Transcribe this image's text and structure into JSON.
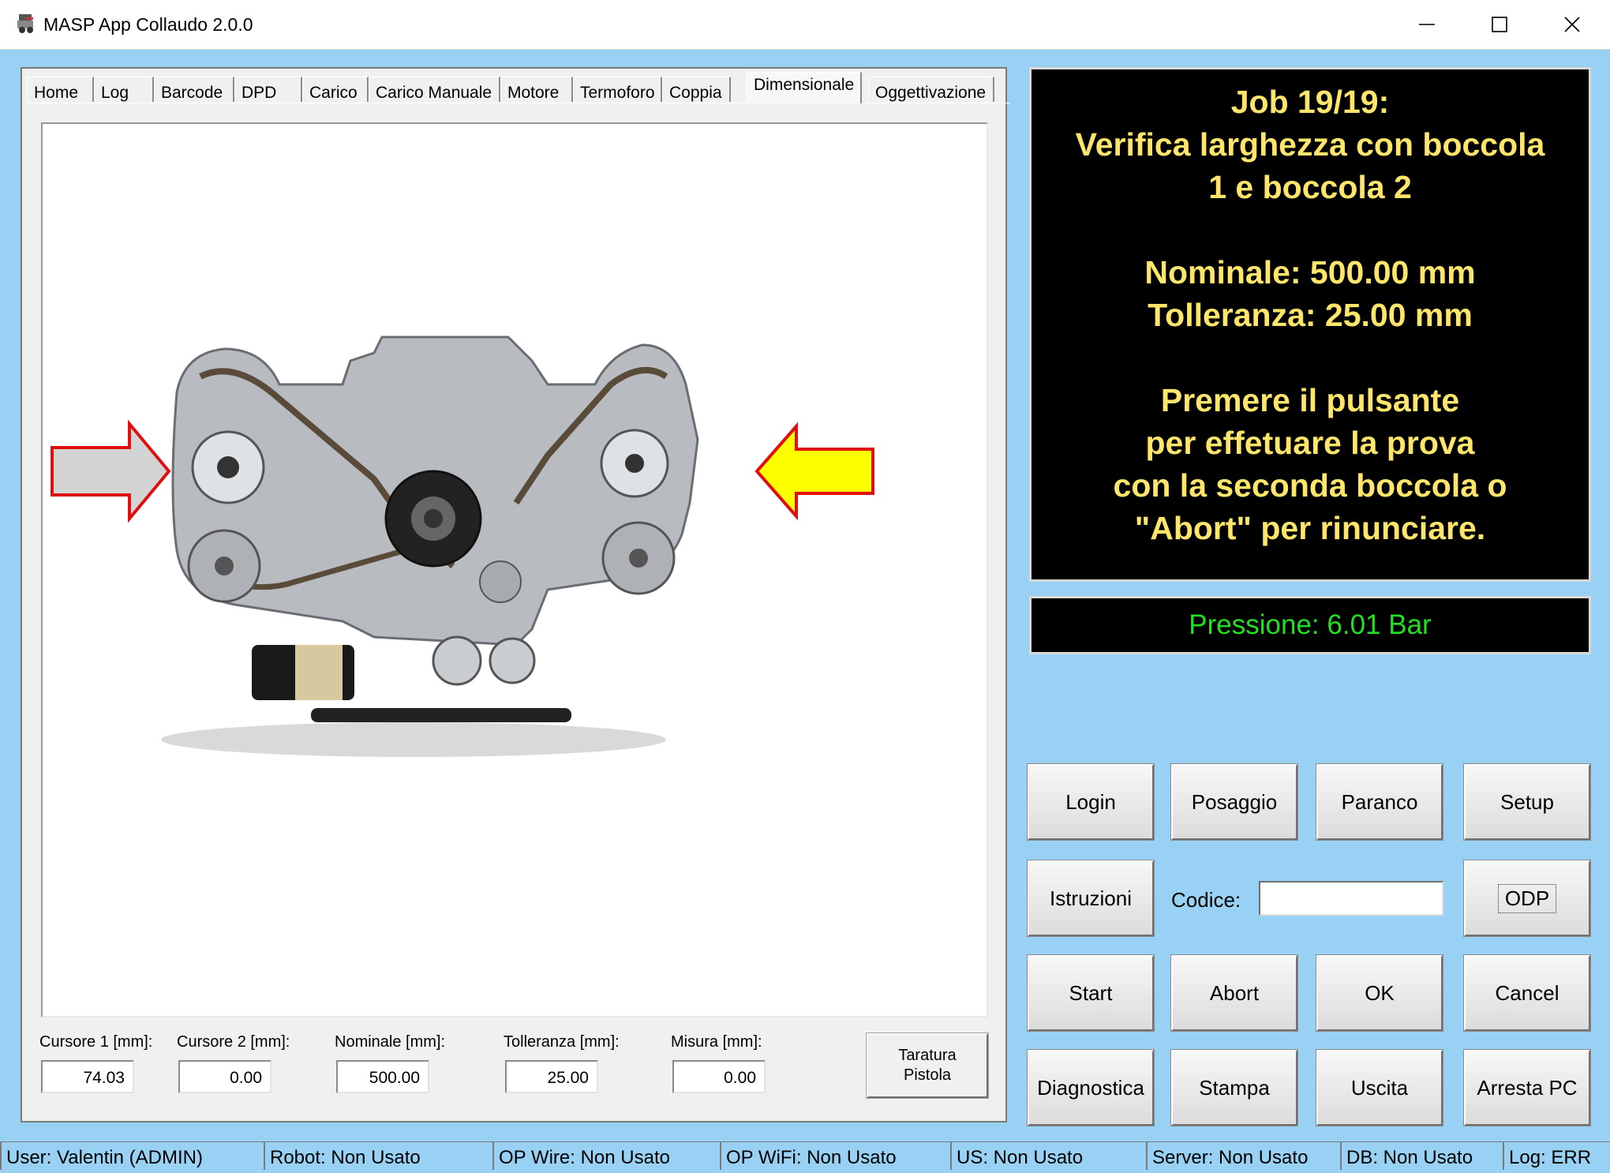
{
  "window": {
    "title": "MASP App Collaudo 2.0.0",
    "icon": "masp-app-icon",
    "controls": [
      "minimize-icon",
      "maximize-icon",
      "close-icon"
    ]
  },
  "tabs": [
    {
      "label": "Home"
    },
    {
      "label": "Log"
    },
    {
      "label": "Barcode"
    },
    {
      "label": "DPD"
    },
    {
      "label": "Carico"
    },
    {
      "label": "Carico Manuale"
    },
    {
      "label": "Motore"
    },
    {
      "label": "Termoforo"
    },
    {
      "label": "Coppia"
    },
    {
      "label": "Dimensionale",
      "active": true
    },
    {
      "label": "Oggettivazione"
    }
  ],
  "image": {
    "subject": "engine-front-view",
    "arrows": [
      "left-arrow-gray-red-outline",
      "right-arrow-yellow-red-outline"
    ]
  },
  "fields": {
    "cursore1": {
      "label": "Cursore 1 [mm]:",
      "value": "74.03"
    },
    "cursore2": {
      "label": "Cursore 2 [mm]:",
      "value": "0.00"
    },
    "nominale": {
      "label": "Nominale [mm]:",
      "value": "500.00"
    },
    "tolleranza": {
      "label": "Tolleranza [mm]:",
      "value": "25.00"
    },
    "misura": {
      "label": "Misura [mm]:",
      "value": "0.00"
    }
  },
  "taratura": {
    "line1": "Taratura",
    "line2": "Pistola"
  },
  "job": {
    "lines": [
      "Job 19/19:",
      "Verifica larghezza con boccola",
      "1 e boccola 2",
      "",
      "Nominale: 500.00 mm",
      "Tolleranza: 25.00 mm",
      "",
      "Premere il pulsante",
      "per effetuare la prova",
      "con la seconda boccola o",
      "\"Abort\" per rinunciare."
    ],
    "color": "#ffe66b"
  },
  "pressure": {
    "text": "Pressione: 6.01 Bar",
    "color": "#22e022"
  },
  "buttons": {
    "login": "Login",
    "posaggio": "Posaggio",
    "paranco": "Paranco",
    "setup": "Setup",
    "istruzioni": "Istruzioni",
    "odp": "ODP",
    "start": "Start",
    "abort": "Abort",
    "ok": "OK",
    "cancel": "Cancel",
    "diagnostica": "Diagnostica",
    "stampa": "Stampa",
    "uscita": "Uscita",
    "arresta": "Arresta PC"
  },
  "codice": {
    "label": "Codice:",
    "value": ""
  },
  "status": [
    "User: Valentin (ADMIN)",
    "Robot: Non Usato",
    "OP Wire: Non Usato",
    "OP WiFi: Non Usato",
    "US: Non Usato",
    "Server: Non Usato",
    "DB: Non Usato",
    "Log: ERR"
  ]
}
